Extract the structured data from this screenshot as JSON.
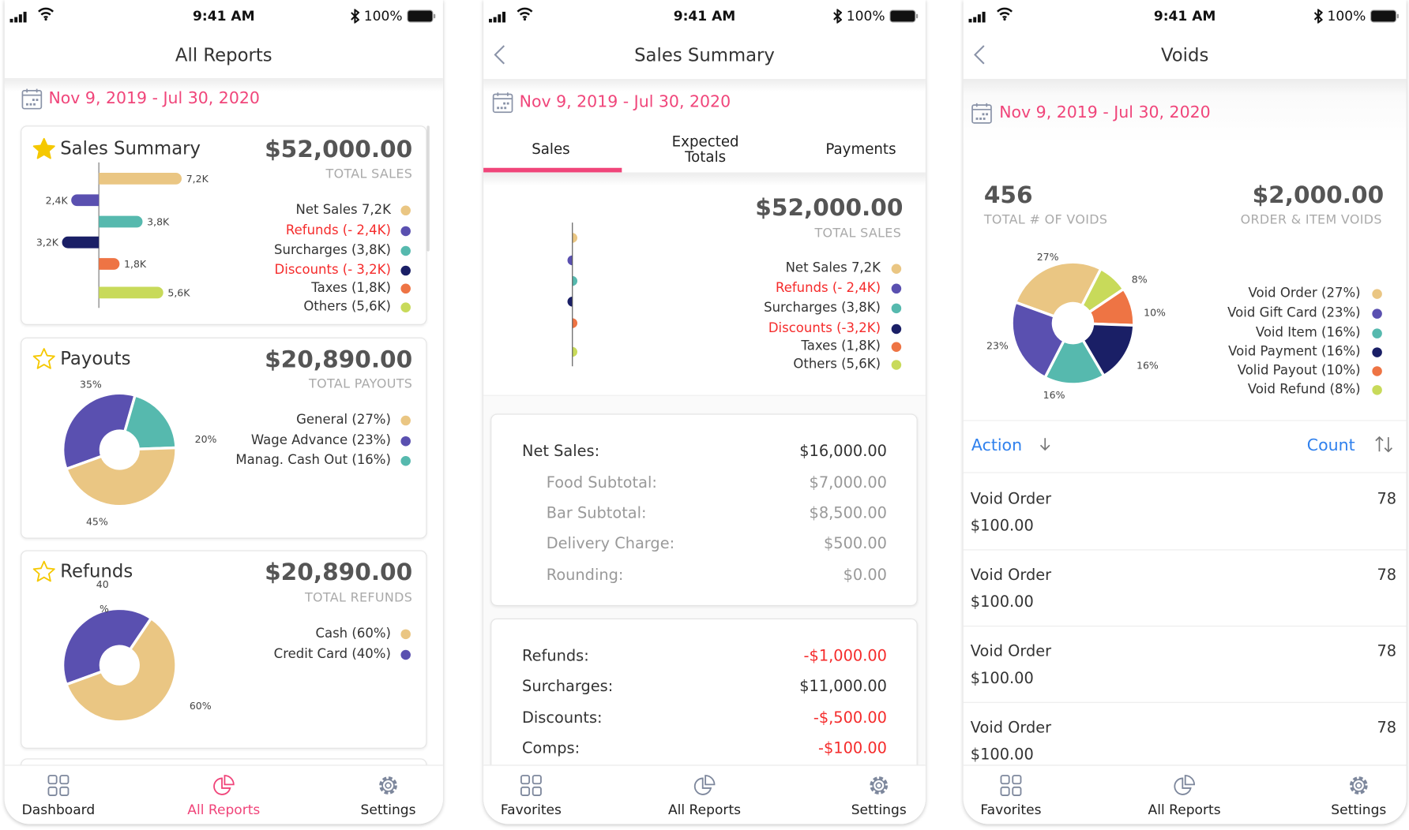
{
  "status_bar": {
    "time": "9:41 AM",
    "battery": "100%"
  },
  "colors": {
    "accent": "#F0457A",
    "negative": "#F52B2B",
    "link": "#2F80ED",
    "tan": "#EAC683",
    "purple": "#5A50B0",
    "teal": "#56B9AE",
    "navy": "#1A1F66",
    "orange": "#EE7444",
    "lime": "#C8DA5A",
    "star": "#F5C800"
  },
  "all_reports": {
    "title": "All Reports",
    "date_range": "Nov 9, 2019 - Jul 30, 2020",
    "sales_card": {
      "title": "Sales Summary",
      "favorite": true,
      "star_icon": "star-filled-icon",
      "amount": "$52,000.00",
      "amount_label": "TOTAL SALES",
      "legend": [
        {
          "label": "Net Sales  7,2K",
          "color": "#EAC683",
          "negative": false
        },
        {
          "label": "Refunds (- 2,4K)",
          "color": "#5A50B0",
          "negative": true
        },
        {
          "label": "Surcharges (3,8K)",
          "color": "#56B9AE",
          "negative": false
        },
        {
          "label": "Discounts (- 3,2K)",
          "color": "#1A1F66",
          "negative": true
        },
        {
          "label": "Taxes (1,8K)",
          "color": "#EE7444",
          "negative": false
        },
        {
          "label": "Others (5,6K)",
          "color": "#C8DA5A",
          "negative": false
        }
      ]
    },
    "payouts_card": {
      "title": "Payouts",
      "favorite": false,
      "star_icon": "star-outline-icon",
      "amount": "$20,890.00",
      "amount_label": "TOTAL PAYOUTS",
      "legend": [
        {
          "label": "General (27%)",
          "color": "#EAC683",
          "negative": false
        },
        {
          "label": "Wage Advance (23%)",
          "color": "#5A50B0",
          "negative": false
        },
        {
          "label": "Manag. Cash Out (16%)",
          "color": "#56B9AE",
          "negative": false
        }
      ]
    },
    "refunds_card": {
      "title": "Refunds",
      "favorite": false,
      "star_icon": "star-outline-icon",
      "amount": "$20,890.00",
      "amount_label": "TOTAL REFUNDS",
      "legend": [
        {
          "label": "Cash (60%)",
          "color": "#EAC683",
          "negative": false
        },
        {
          "label": "Credit Card (40%)",
          "color": "#5A50B0",
          "negative": false
        }
      ]
    },
    "tabs": [
      {
        "label": "Dashboard",
        "icon": "grid-icon",
        "active": false
      },
      {
        "label": "All Reports",
        "icon": "pie-chart-icon",
        "active": true
      },
      {
        "label": "Settings",
        "icon": "gear-icon",
        "active": false
      }
    ]
  },
  "sales_summary": {
    "title": "Sales Summary",
    "back_icon": "chevron-left-icon",
    "date_range": "Nov 9, 2019 - Jul 30, 2020",
    "segments": [
      {
        "label": "Sales",
        "active": true
      },
      {
        "label": "Expected\nTotals",
        "active": false
      },
      {
        "label": "Payments",
        "active": false
      }
    ],
    "amount": "$52,000.00",
    "amount_label": "TOTAL SALES",
    "legend": [
      {
        "label": "Net Sales  7,2K",
        "color": "#EAC683",
        "negative": false
      },
      {
        "label": "Refunds (- 2,4K)",
        "color": "#5A50B0",
        "negative": true
      },
      {
        "label": "Surcharges (3,8K)",
        "color": "#56B9AE",
        "negative": false
      },
      {
        "label": "Discounts (-3,2K)",
        "color": "#1A1F66",
        "negative": true
      },
      {
        "label": "Taxes (1,8K)",
        "color": "#EE7444",
        "negative": false
      },
      {
        "label": "Others (5,6K)",
        "color": "#C8DA5A",
        "negative": false
      }
    ],
    "net_sales_card": [
      {
        "label": "Net Sales:",
        "value": "$16,000.00",
        "sub": false,
        "negative": false
      },
      {
        "label": "Food Subtotal:",
        "value": "$7,000.00",
        "sub": true,
        "negative": false
      },
      {
        "label": "Bar Subtotal:",
        "value": "$8,500.00",
        "sub": true,
        "negative": false
      },
      {
        "label": "Delivery Charge:",
        "value": "$500.00",
        "sub": true,
        "negative": false
      },
      {
        "label": "Rounding:",
        "value": "$0.00",
        "sub": true,
        "negative": false
      }
    ],
    "adjustments_card": [
      {
        "label": "Refunds:",
        "value": "-$1,000.00",
        "sub": false,
        "negative": true
      },
      {
        "label": "Surcharges:",
        "value": "$11,000.00",
        "sub": false,
        "negative": false
      },
      {
        "label": "Discounts:",
        "value": "-$,500.00",
        "sub": false,
        "negative": true
      },
      {
        "label": "Comps:",
        "value": "-$100.00",
        "sub": false,
        "negative": true
      }
    ],
    "tabs": [
      {
        "label": "Favorites",
        "icon": "grid-icon",
        "active": false
      },
      {
        "label": "All Reports",
        "icon": "pie-chart-icon",
        "active": false
      },
      {
        "label": "Settings",
        "icon": "gear-icon",
        "active": false
      }
    ]
  },
  "voids": {
    "title": "Voids",
    "back_icon": "chevron-left-icon",
    "date_range": "Nov 9, 2019 - Jul 30, 2020",
    "count": "456",
    "count_label": "TOTAL # OF VOIDS",
    "amount": "$2,000.00",
    "amount_label": "ORDER & ITEM VOIDS",
    "legend": [
      {
        "label": "Void Order (27%)",
        "color": "#EAC683",
        "negative": false
      },
      {
        "label": "Void Gift Card (23%)",
        "color": "#5A50B0",
        "negative": false
      },
      {
        "label": "Void Item (16%)",
        "color": "#56B9AE",
        "negative": false
      },
      {
        "label": "Void Payment (16%)",
        "color": "#1A1F66",
        "negative": false
      },
      {
        "label": "Volid Payout (10%)",
        "color": "#EE7444",
        "negative": false
      },
      {
        "label": "Void Refund (8%)",
        "color": "#C8DA5A",
        "negative": false
      }
    ],
    "sort": {
      "action_label": "Action",
      "action_icon": "arrow-down-icon",
      "count_label": "Count",
      "count_icon": "sort-icon"
    },
    "rows": [
      {
        "title": "Void Order",
        "amount": "$100.00",
        "count": "78"
      },
      {
        "title": "Void Order",
        "amount": "$100.00",
        "count": "78"
      },
      {
        "title": "Void Order",
        "amount": "$100.00",
        "count": "78"
      },
      {
        "title": "Void Order",
        "amount": "$100.00",
        "count": "78"
      }
    ],
    "tabs": [
      {
        "label": "Favorites",
        "icon": "grid-icon",
        "active": false
      },
      {
        "label": "All Reports",
        "icon": "pie-chart-icon",
        "active": false
      },
      {
        "label": "Settings",
        "icon": "gear-icon",
        "active": false
      }
    ]
  },
  "chart_data": [
    {
      "type": "bar",
      "orientation": "horizontal",
      "categories": [
        "Net Sales",
        "Refunds",
        "Surcharges",
        "Discounts",
        "Taxes",
        "Others"
      ],
      "values": [
        7.2,
        -2.4,
        3.8,
        -3.2,
        1.8,
        5.6
      ],
      "value_labels": [
        "7,2K",
        "2,4K",
        "3,8K",
        "3,2K",
        "1,8K",
        "5,6K"
      ],
      "colors": [
        "#EAC683",
        "#5A50B0",
        "#56B9AE",
        "#1A1F66",
        "#EE7444",
        "#C8DA5A"
      ],
      "unit": "K",
      "grid": false
    },
    {
      "type": "pie",
      "style": "donut",
      "values": [
        35,
        20,
        45
      ],
      "slice_labels": [
        "35%",
        "20%",
        "45%"
      ],
      "colors": [
        "#5A50B0",
        "#56B9AE",
        "#EAC683"
      ]
    },
    {
      "type": "pie",
      "style": "donut",
      "values": [
        40,
        60
      ],
      "slice_labels": [
        "40",
        "%",
        "60%"
      ],
      "colors": [
        "#5A50B0",
        "#EAC683"
      ]
    },
    {
      "type": "scatter",
      "style": "half-dots on axis",
      "categories": [
        "Net Sales",
        "Refunds",
        "Surcharges",
        "Discounts",
        "Taxes",
        "Others"
      ],
      "values": [
        7.2,
        -2.4,
        3.8,
        -3.2,
        1.8,
        5.6
      ],
      "colors": [
        "#EAC683",
        "#5A50B0",
        "#56B9AE",
        "#1A1F66",
        "#EE7444",
        "#C8DA5A"
      ]
    },
    {
      "type": "pie",
      "style": "donut",
      "categories": [
        "Void Order",
        "Void Refund",
        "Volid Payout",
        "Void Payment",
        "Void Item",
        "Void Gift Card"
      ],
      "values": [
        27,
        8,
        10,
        16,
        16,
        23
      ],
      "slice_labels": [
        "27%",
        "8%",
        "10%",
        "16%",
        "16%",
        "23%"
      ],
      "colors": [
        "#EAC683",
        "#C8DA5A",
        "#EE7444",
        "#1A1F66",
        "#56B9AE",
        "#5A50B0"
      ]
    }
  ]
}
